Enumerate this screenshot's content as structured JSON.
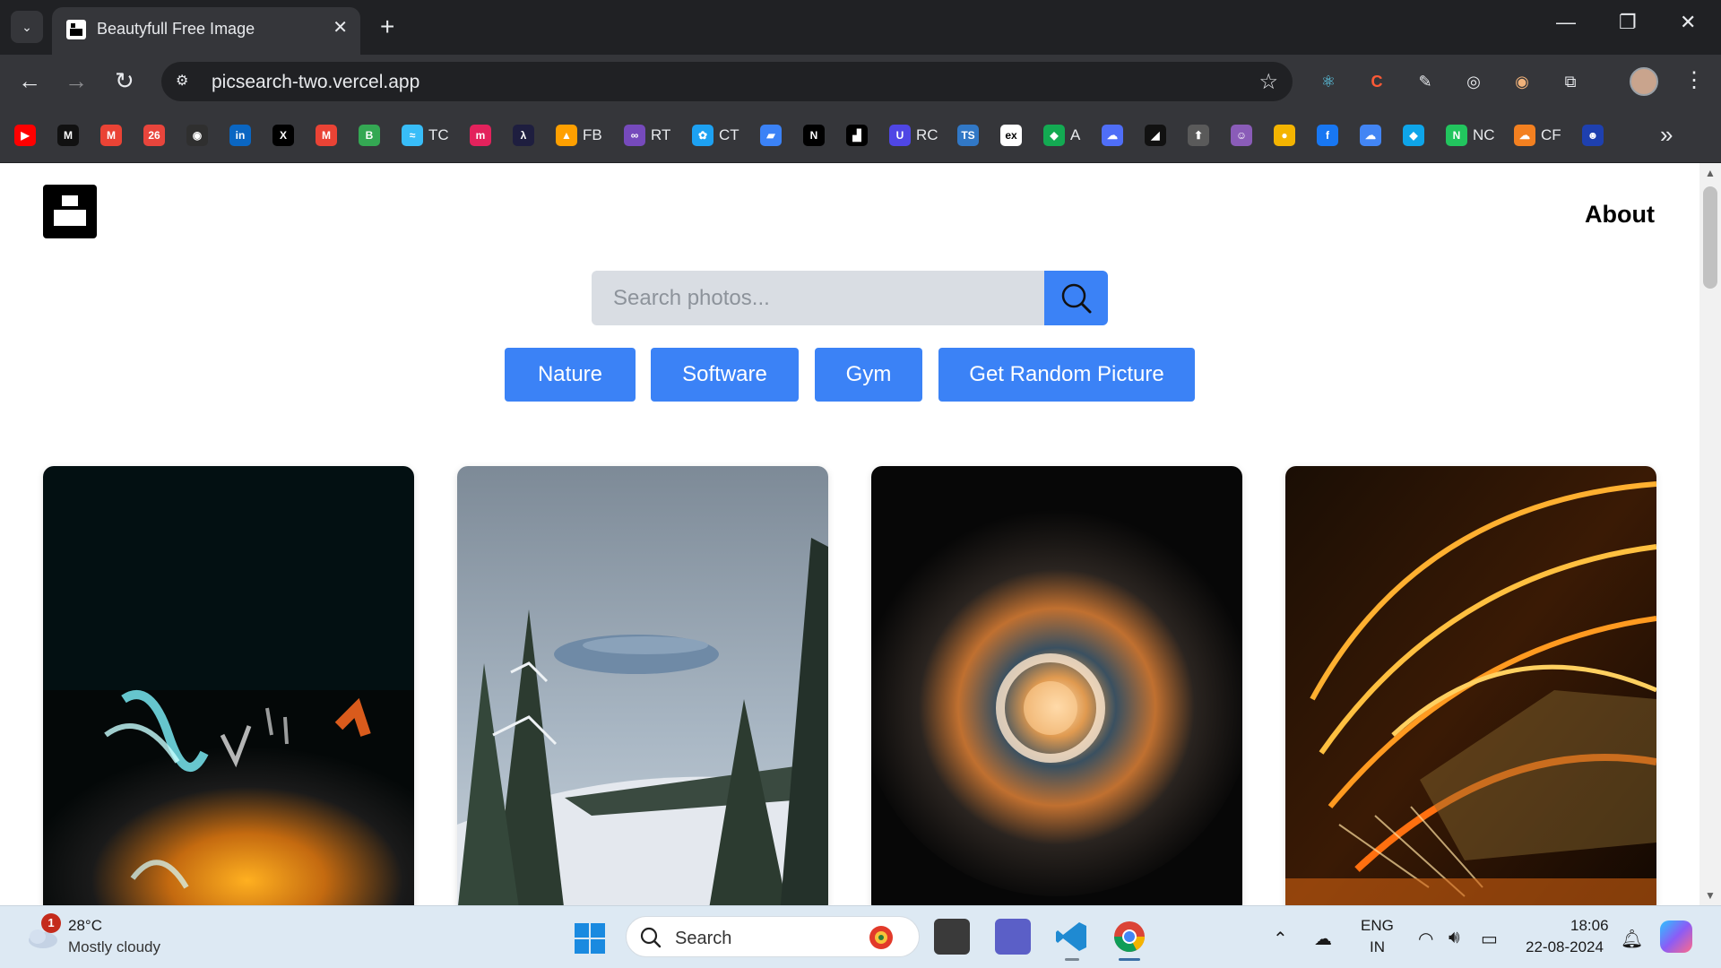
{
  "browser": {
    "tab": {
      "title": "Beautyfull Free Image",
      "close_glyph": "✕"
    },
    "new_tab_glyph": "+",
    "window_controls": {
      "minimize": "—",
      "restore": "❐",
      "close": "✕"
    },
    "url": "picsearch-two.vercel.app",
    "bookmarks": [
      {
        "icon": "youtube-icon",
        "color": "#ff0000",
        "glyph": "▶",
        "label": ""
      },
      {
        "icon": "m-icon",
        "color": "#111111",
        "glyph": "M",
        "label": ""
      },
      {
        "icon": "gmail-icon",
        "color": "#ea4335",
        "glyph": "M",
        "label": ""
      },
      {
        "icon": "leetcode-icon",
        "color": "#e8453c",
        "glyph": "26",
        "label": ""
      },
      {
        "icon": "github-icon",
        "color": "#2f2f2f",
        "glyph": "◉",
        "label": ""
      },
      {
        "icon": "linkedin-icon",
        "color": "#0a66c2",
        "glyph": "in",
        "label": ""
      },
      {
        "icon": "x-icon",
        "color": "#000000",
        "glyph": "X",
        "label": ""
      },
      {
        "icon": "gmail-icon",
        "color": "#ea4335",
        "glyph": "M",
        "label": ""
      },
      {
        "icon": "bootstrap-icon",
        "color": "#34a853",
        "glyph": "B",
        "label": ""
      },
      {
        "icon": "tailwind-icon",
        "color": "#38bdf8",
        "glyph": "≈",
        "label": "TC"
      },
      {
        "icon": "m-logo-icon",
        "color": "#e3225c",
        "glyph": "m",
        "label": ""
      },
      {
        "icon": "lambda-icon",
        "color": "#1e1e3f",
        "glyph": "λ",
        "label": ""
      },
      {
        "icon": "firebase-icon",
        "color": "#ffa000",
        "glyph": "▲",
        "label": "FB"
      },
      {
        "icon": "redux-icon",
        "color": "#764abc",
        "glyph": "∞",
        "label": "RT"
      },
      {
        "icon": "paw-icon",
        "color": "#1da1f2",
        "glyph": "✿",
        "label": "CT"
      },
      {
        "icon": "flag-icon",
        "color": "#3b82f6",
        "glyph": "▰",
        "label": ""
      },
      {
        "icon": "nextjs-icon",
        "color": "#000000",
        "glyph": "N",
        "label": ""
      },
      {
        "icon": "unsplash-icon",
        "color": "#000000",
        "glyph": "▟",
        "label": ""
      },
      {
        "icon": "u-icon",
        "color": "#4f46e5",
        "glyph": "U",
        "label": "RC"
      },
      {
        "icon": "typescript-icon",
        "color": "#3178c6",
        "glyph": "TS",
        "label": ""
      },
      {
        "icon": "express-icon",
        "color": "#ffffff",
        "glyph": "ex",
        "label": ""
      },
      {
        "icon": "mongodb-icon",
        "color": "#13aa52",
        "glyph": "◆",
        "label": "A"
      },
      {
        "icon": "cloud-icon",
        "color": "#4f6ef7",
        "glyph": "☁",
        "label": ""
      },
      {
        "icon": "shapes-icon",
        "color": "#111111",
        "glyph": "◢",
        "label": ""
      },
      {
        "icon": "rocket-icon",
        "color": "#5a5a5a",
        "glyph": "⬆",
        "label": ""
      },
      {
        "icon": "avatar-icon",
        "color": "#8a5cb8",
        "glyph": "☺",
        "label": ""
      },
      {
        "icon": "dot-icon",
        "color": "#f4b400",
        "glyph": "●",
        "label": ""
      },
      {
        "icon": "facebook-icon",
        "color": "#1877f2",
        "glyph": "f",
        "label": ""
      },
      {
        "icon": "google-cloud-icon",
        "color": "#4285f4",
        "glyph": "☁",
        "label": ""
      },
      {
        "icon": "azure-icon",
        "color": "#0ea5e9",
        "glyph": "◆",
        "label": ""
      },
      {
        "icon": "n-logo-icon",
        "color": "#22c55e",
        "glyph": "N",
        "label": "NC"
      },
      {
        "icon": "cloudflare-icon",
        "color": "#f38020",
        "glyph": "☁",
        "label": "CF"
      },
      {
        "icon": "profile-icon",
        "color": "#1e40af",
        "glyph": "☻",
        "label": ""
      }
    ],
    "bookmarks_more_glyph": "»"
  },
  "site": {
    "nav": {
      "about": "About"
    },
    "search": {
      "placeholder": "Search photos..."
    },
    "chips": [
      "Nature",
      "Software",
      "Gym",
      "Get Random Picture"
    ],
    "photos": [
      {
        "name": "photo-light-trails",
        "subject": "blurred night light trails"
      },
      {
        "name": "photo-snowy-forest",
        "subject": "snowy pine forest with lenticular cloud"
      },
      {
        "name": "photo-nebula",
        "subject": "planetary nebula"
      },
      {
        "name": "photo-illuminated-structure",
        "subject": "glowing steel walkway at night"
      }
    ],
    "accent_color": "#3b82f6"
  },
  "taskbar": {
    "weather": {
      "badge": "1",
      "temp": "28°C",
      "desc": "Mostly cloudy"
    },
    "search_label": "Search",
    "lang": {
      "line1": "ENG",
      "line2": "IN"
    },
    "clock": {
      "time": "18:06",
      "date": "22-08-2024"
    }
  }
}
